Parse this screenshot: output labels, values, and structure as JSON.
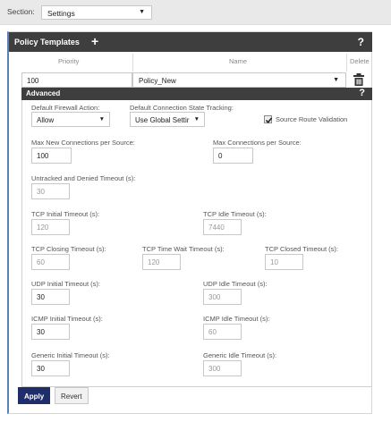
{
  "section": {
    "label": "Section:",
    "value": "Settings"
  },
  "policy_templates": {
    "title": "Policy Templates",
    "add_icon": "+",
    "help_icon": "?",
    "columns": {
      "priority": "Priority",
      "name": "Name",
      "delete": "Delete"
    },
    "row": {
      "priority": "100",
      "name": "Policy_New"
    }
  },
  "advanced": {
    "title": "Advanced",
    "help_icon": "?",
    "default_firewall_action": {
      "label": "Default Firewall Action:",
      "value": "Allow"
    },
    "default_conn_state": {
      "label": "Default Connection State Tracking:",
      "value": "Use Global Settir"
    },
    "source_route_validation": {
      "label": "Source Route Validation",
      "checked": true
    },
    "max_new_conn": {
      "label": "Max New Connections per Source:",
      "value": "100"
    },
    "max_conn": {
      "label": "Max Connections per Source:",
      "value": "0"
    },
    "untracked_denied_timeout": {
      "label": "Untracked and Denied Timeout (s):",
      "value": "30"
    },
    "tcp_initial_timeout": {
      "label": "TCP Initial Timeout (s):",
      "value": "120"
    },
    "tcp_idle_timeout": {
      "label": "TCP Idle Timeout (s):",
      "value": "7440"
    },
    "tcp_closing_timeout": {
      "label": "TCP Closing Timeout (s):",
      "value": "60"
    },
    "tcp_time_wait_timeout": {
      "label": "TCP Time Wait Timeout (s):",
      "value": "120"
    },
    "tcp_closed_timeout": {
      "label": "TCP Closed Timeout (s):",
      "value": "10"
    },
    "udp_initial_timeout": {
      "label": "UDP Initial Timeout (s):",
      "value": "30"
    },
    "udp_idle_timeout": {
      "label": "UDP Idle Timeout (s):",
      "value": "300"
    },
    "icmp_initial_timeout": {
      "label": "ICMP Initial Timeout (s):",
      "value": "30"
    },
    "icmp_idle_timeout": {
      "label": "ICMP Idle Timeout (s):",
      "value": "60"
    },
    "generic_initial_timeout": {
      "label": "Generic Initial Timeout (s):",
      "value": "30"
    },
    "generic_idle_timeout": {
      "label": "Generic Idle Timeout (s):",
      "value": "300"
    }
  },
  "buttons": {
    "apply": "Apply",
    "revert": "Revert"
  },
  "icons": {
    "caret": "chevron-down-icon",
    "delete": "trash-icon",
    "check": "check-icon"
  },
  "colors": {
    "header_bg": "#3e3e3e",
    "apply_bg": "#1f2d6b",
    "accent_border": "#5b7fbf"
  }
}
